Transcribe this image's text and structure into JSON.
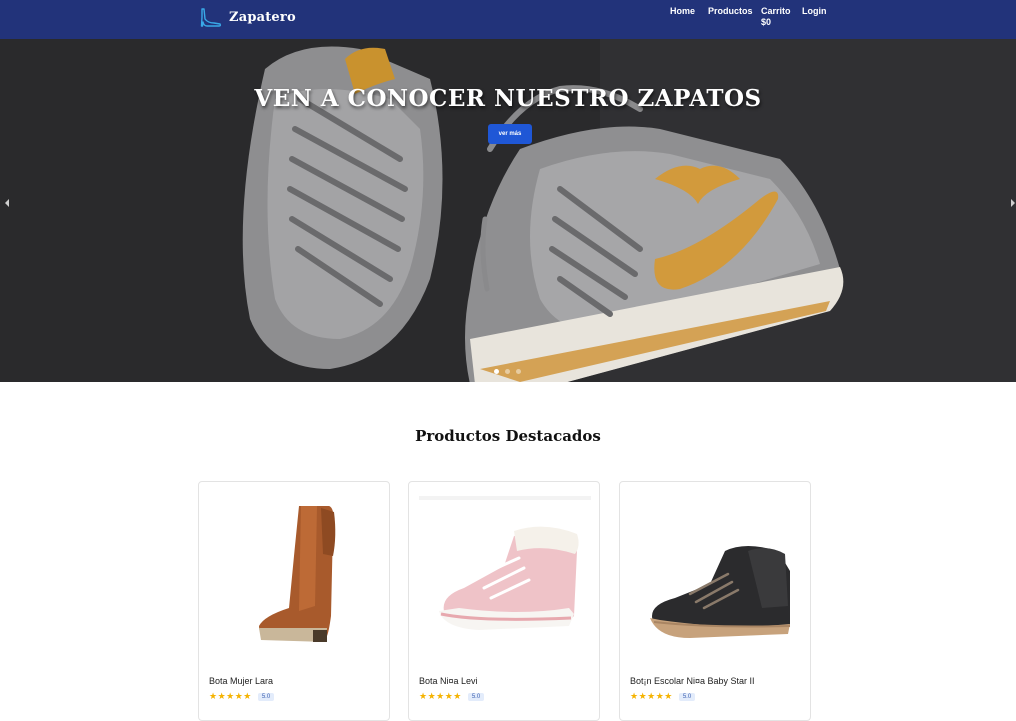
{
  "navbar": {
    "brand": "Zapatero",
    "brand_icon": "high-heel-shoe-icon",
    "items": {
      "home": "Home",
      "products": "Productos",
      "cart": "Carrito",
      "cart_total": "$0",
      "login": "Login"
    }
  },
  "hero": {
    "title": "VEN A CONOCER NUESTRO ZAPATOS",
    "button": "ver más",
    "slide_count": 3,
    "active_slide": 1
  },
  "featured": {
    "title": "Productos Destacados",
    "products": [
      {
        "name": "Bota Mujer Lara",
        "stars": "★★★★★",
        "score": "5.0"
      },
      {
        "name": "Bota Ni¤a Levi",
        "stars": "★★★★★",
        "score": "5.0"
      },
      {
        "name": "Bot¡n Escolar Ni¤a Baby Star II",
        "stars": "★★★★★",
        "score": "5.0"
      }
    ]
  },
  "colors": {
    "navbar": "#22337a",
    "button": "#1f57d6",
    "stars": "#f5b301"
  }
}
